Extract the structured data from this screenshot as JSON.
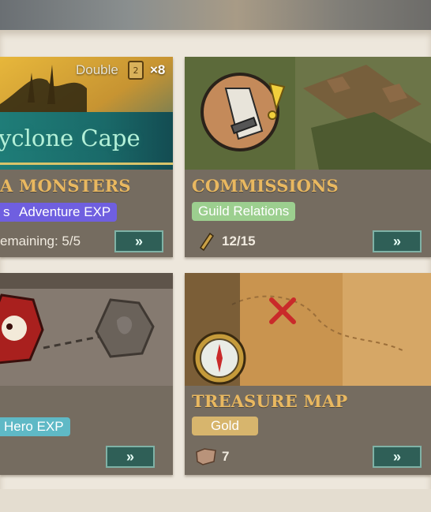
{
  "cards": {
    "sea_monsters": {
      "title": "A MONSTERS",
      "banner_name": "yclone Cape",
      "double_label": "Double",
      "multiplier": "×8",
      "tags": [
        "s",
        "Adventure EXP"
      ],
      "remaining": "emaining: 5/5",
      "go_label": "»"
    },
    "commissions": {
      "title": "COMMISSIONS",
      "tags": [
        "Guild Relations"
      ],
      "count": "12/15",
      "go_label": "»"
    },
    "bounty": {
      "tags": [
        "Hero EXP"
      ],
      "go_label": "»"
    },
    "treasure_map": {
      "title": "TREASURE MAP",
      "tags": [
        "Gold"
      ],
      "count": "7",
      "go_label": "»"
    }
  },
  "colors": {
    "card_bg": "#756c60",
    "title_gold": "#e9b860",
    "go_button": "#2f5f57",
    "purple_tag": "#6f5fe0",
    "green_tag": "#9ccf8f",
    "teal_tag": "#5fb9c6",
    "gold_tag": "#d7b56d"
  },
  "icons": [
    "scroll-icon",
    "exclamation-icon",
    "pirate-skull-icon",
    "faded-skull-icon",
    "compass-icon",
    "x-mark-icon",
    "spyglass-icon",
    "map-fragment-icon",
    "double-ticket-icon"
  ]
}
